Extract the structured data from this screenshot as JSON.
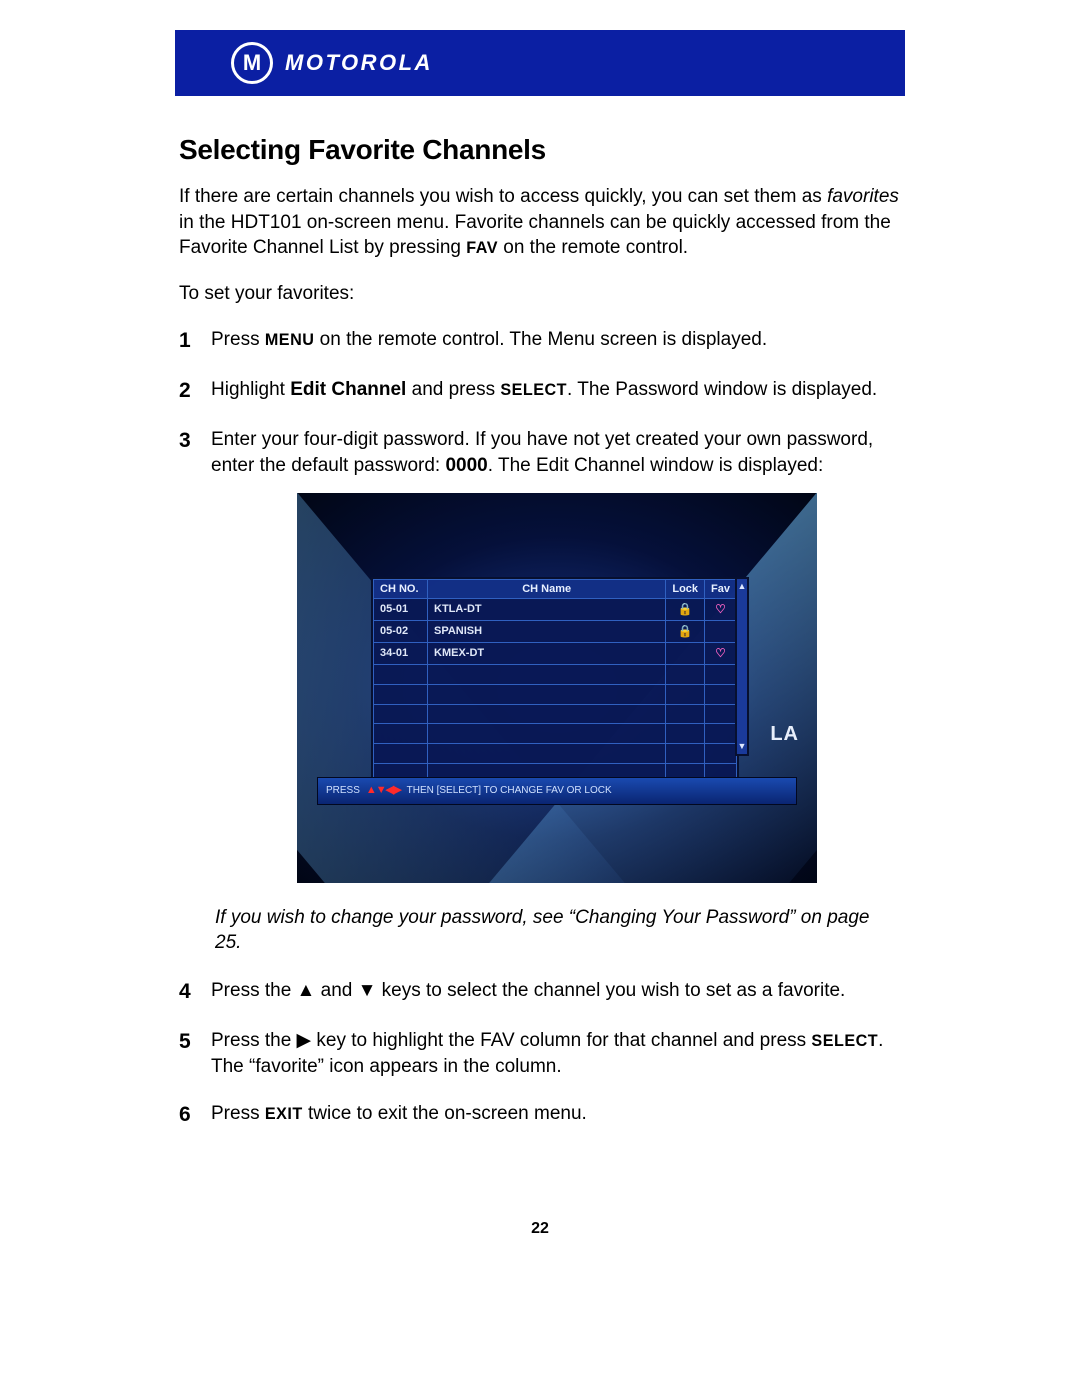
{
  "brand": "MOTOROLA",
  "section_title": "Selecting Favorite Channels",
  "intro": {
    "p1_a": "If there are certain channels you wish to access quickly, you can set them as ",
    "p1_em": "favorites",
    "p1_b": " in the HDT101 on-screen menu. Favorite channels can be quickly accessed from the Favorite Channel List by pressing ",
    "p1_key": "FAV",
    "p1_c": " on the remote control."
  },
  "lead": "To set your favorites:",
  "steps": {
    "s1_a": "Press ",
    "s1_key": "MENU",
    "s1_b": " on the remote control. The Menu screen is displayed.",
    "s2_a": "Highlight ",
    "s2_bold": "Edit Channel",
    "s2_b": " and press ",
    "s2_key": "SELECT",
    "s2_c": ". The Password window is displayed.",
    "s3_a": "Enter your four-digit password. If you have not yet created your own password, enter the default password: ",
    "s3_bold": "0000",
    "s3_b": ". The Edit Channel window is displayed:",
    "s4_a": "Press the ▲ and ▼ keys to select the channel you wish to set as a favorite.",
    "s5_a": "Press the ▶ key to highlight the FAV column for that channel and press ",
    "s5_key": "SELECT",
    "s5_b": ". The “favorite” icon appears in the column.",
    "s6_a": "Press ",
    "s6_key": "EXIT",
    "s6_b": " twice to exit the on-screen menu."
  },
  "password_note": "If you wish to change your password, see “Changing Your Password” on page 25.",
  "tv": {
    "headers": {
      "no": "CH NO.",
      "name": "CH  Name",
      "lock": "Lock",
      "fav": "Fav"
    },
    "rows": [
      {
        "no": "05-01",
        "name": "KTLA-DT",
        "lock": true,
        "fav": true
      },
      {
        "no": "05-02",
        "name": "SPANISH",
        "lock": true,
        "fav": false
      },
      {
        "no": "34-01",
        "name": "KMEX-DT",
        "lock": false,
        "fav": true
      }
    ],
    "blank_rows": 6,
    "instr_a": "PRESS ",
    "instr_arrows": "▲▼◀▶",
    "instr_b": " THEN [SELECT] TO CHANGE FAV OR LOCK",
    "la": "LA"
  },
  "page_number": "22"
}
